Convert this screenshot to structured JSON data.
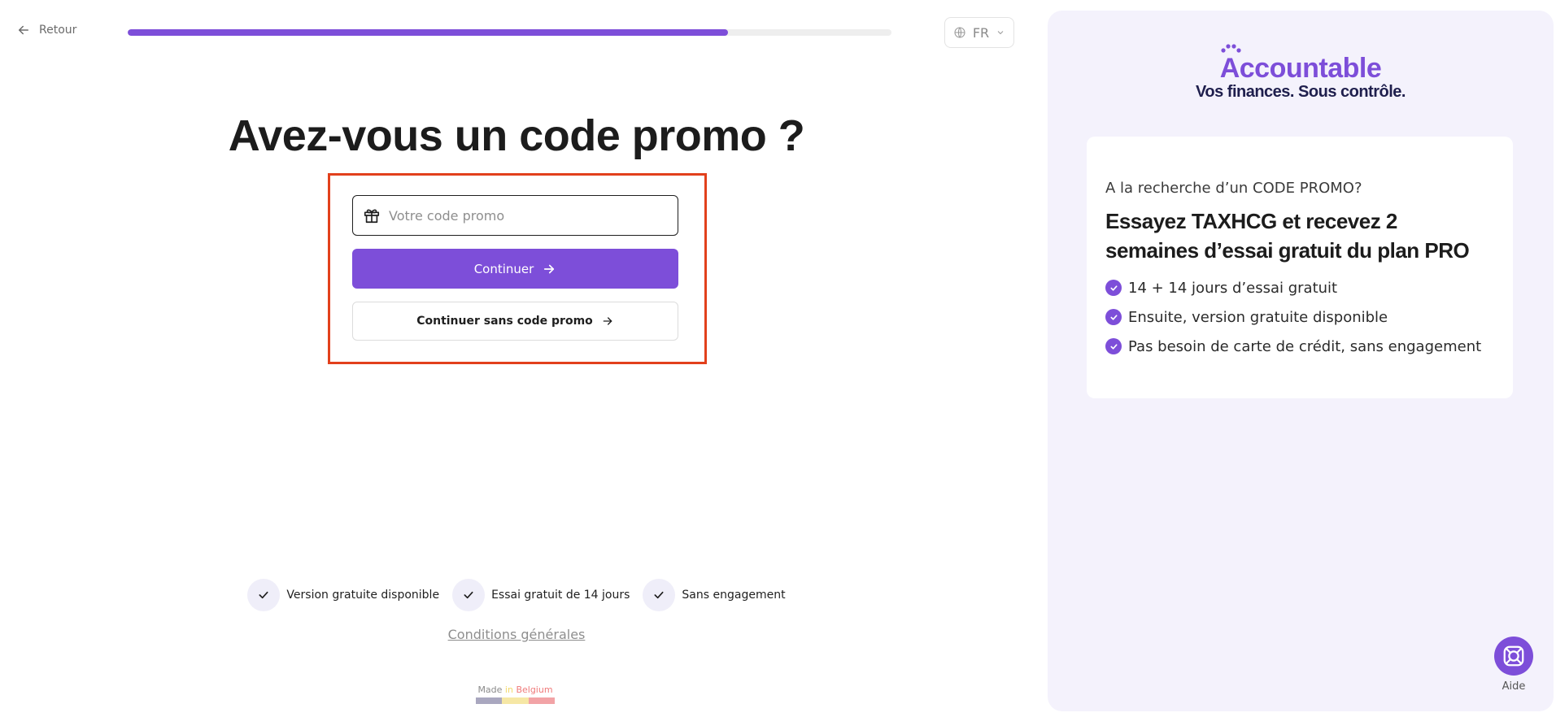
{
  "nav": {
    "back_label": "Retour",
    "progress_percent": 78.6
  },
  "language": {
    "selected": "FR"
  },
  "main": {
    "title": "Avez-vous un code promo ?",
    "promo_placeholder": "Votre code promo",
    "promo_value": "",
    "continue_label": "Continuer",
    "skip_label": "Continuer sans code promo"
  },
  "features": [
    {
      "label": "Version gratuite disponible"
    },
    {
      "label": "Essai gratuit de 14 jours"
    },
    {
      "label": "Sans engagement"
    }
  ],
  "footer": {
    "terms_label": "Conditions générales",
    "made_word": "Made",
    "in_word": "in",
    "country_word": "Belgium",
    "flag_colors": [
      "#a9a7bf",
      "#f6e7a5",
      "#f2a3a6"
    ]
  },
  "brand": {
    "name": "Accountable",
    "tagline": "Vos finances. Sous contrôle.",
    "accent": "#7d4ed9"
  },
  "promo_card": {
    "kicker": "A la recherche d’un CODE PROMO?",
    "headline": "Essayez TAXHCG et recevez 2 semaines d’essai gratuit du plan PRO",
    "bullets": [
      "14 + 14 jours d’essai gratuit",
      "Ensuite, version gratuite disponible",
      "Pas besoin de carte de crédit, sans engagement"
    ]
  },
  "help": {
    "label": "Aide"
  },
  "icons": {
    "back": "arrow-left-icon",
    "globe": "globe-icon",
    "chevron": "chevron-down-icon",
    "gift": "gift-icon",
    "arrow": "arrow-right-icon",
    "check": "check-icon",
    "help": "lifebuoy-icon"
  }
}
